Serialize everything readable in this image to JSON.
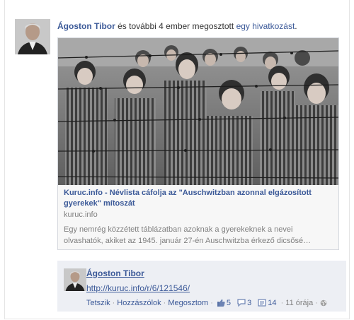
{
  "story": {
    "actor_name": "Ágoston Tibor",
    "middle_text": " és további 4 ember",
    "verb_text": " megosztott ",
    "object_link": "egy hivatkozást",
    "end_punct": "."
  },
  "share": {
    "title": "Kuruc.info - Névlista cáfolja az \"Auschwitzban azonnal elgázosított gyerekek\" mítoszát",
    "domain": "kuruc.info",
    "description": "Egy nemrég közzétett táblázatban azoknak a gyerekeknek a nevei olvashatók, akiket az 1945. január 27-én Auschwitzba érkező dicsősé…"
  },
  "comment": {
    "author": "Ágoston Tibor",
    "link": "http://kuruc.info/r/6/121546/",
    "actions": {
      "like": "Tetszik",
      "comment": "Hozzászólok",
      "share": "Megosztom",
      "likes_count": "5",
      "comments_count": "3",
      "shares_count": "14",
      "time": "11 órája",
      "sep": "·"
    }
  },
  "colors": {
    "link": "#3b5998",
    "muted": "#808080",
    "comment_bg": "#edeff4"
  },
  "icons": {
    "like": "thumbs-up-icon",
    "comment": "comment-bubble-icon",
    "share": "share-icon",
    "privacy": "globe-icon"
  }
}
